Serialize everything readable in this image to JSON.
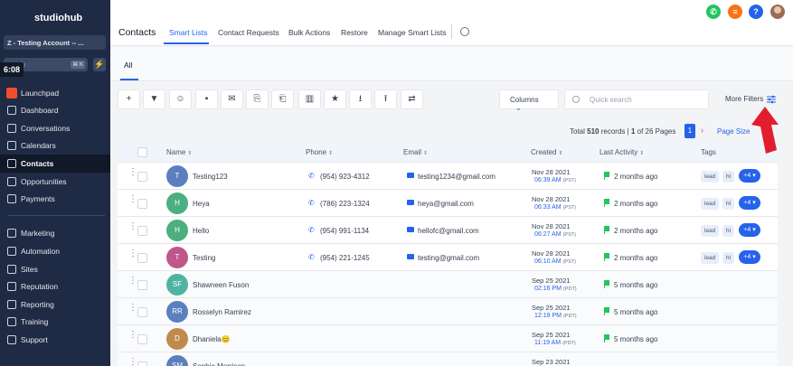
{
  "sidebar": {
    "logo": "studiohub",
    "account": "Z - Testing Account -- ...",
    "search_placeholder": "earch",
    "search_kbd": "⌘ K",
    "time_badge": "6:08",
    "items": [
      {
        "label": "Launchpad",
        "icon": "launchpad-icon"
      },
      {
        "label": "Dashboard",
        "icon": "dashboard-icon"
      },
      {
        "label": "Conversations",
        "icon": "chat-icon"
      },
      {
        "label": "Calendars",
        "icon": "calendar-icon"
      },
      {
        "label": "Contacts",
        "icon": "contacts-icon",
        "active": true
      },
      {
        "label": "Opportunities",
        "icon": "opportunities-icon"
      },
      {
        "label": "Payments",
        "icon": "payments-icon"
      },
      {
        "label": "Marketing",
        "icon": "marketing-icon"
      },
      {
        "label": "Automation",
        "icon": "automation-icon"
      },
      {
        "label": "Sites",
        "icon": "sites-icon"
      },
      {
        "label": "Reputation",
        "icon": "reputation-icon"
      },
      {
        "label": "Reporting",
        "icon": "reporting-icon"
      },
      {
        "label": "Training",
        "icon": "training-icon"
      },
      {
        "label": "Support",
        "icon": "support-icon"
      }
    ]
  },
  "header": {
    "title": "Contacts",
    "tabs": [
      "Smart Lists",
      "Contact Requests",
      "Bulk Actions",
      "Restore",
      "Manage Smart Lists"
    ],
    "help_label": "?",
    "colors": {
      "phone": "#22c55e",
      "menu": "#f97316",
      "help": "#2563eb"
    }
  },
  "subtabs": {
    "all": "All"
  },
  "toolbar": {
    "icons": [
      "plus-icon",
      "filter-icon",
      "robot-icon",
      "message-icon",
      "email-icon",
      "copy-in-icon",
      "copy-out-icon",
      "trash-icon",
      "star-icon",
      "download-icon",
      "upload-icon",
      "merge-icon"
    ],
    "icon_glyphs": [
      "+",
      "▼",
      "☺",
      "▪",
      "✉",
      "⎘",
      "⎗",
      "▥",
      "★",
      "⭳",
      "⭱",
      "⇄"
    ],
    "columns_label": "Columns",
    "search_placeholder": "Quick search",
    "more_filters": "More Filters"
  },
  "pagination": {
    "total_prefix": "Total",
    "total": "510",
    "total_suffix": "records |",
    "page": "1",
    "page_of": "of 26 Pages",
    "current": "1",
    "next": "›",
    "page_size": "Page Size"
  },
  "table": {
    "columns": [
      "Name",
      "Phone",
      "Email",
      "Created",
      "Last Activity",
      "Tags"
    ],
    "rows": [
      {
        "initials": "T",
        "name": "Testing123",
        "color": "#5b7fbf",
        "phone": "(954) 923-4312",
        "email": "testing1234@gmail.com",
        "date": "Nov 28 2021",
        "time": "06:39 AM",
        "tz": "(PST)",
        "activity": "2 months ago",
        "tags": [
          "lead",
          "hl"
        ],
        "more": "+4 ▾"
      },
      {
        "initials": "H",
        "name": "Heya",
        "color": "#4caf80",
        "phone": "(786) 223-1324",
        "email": "heya@gmail.com",
        "date": "Nov 28 2021",
        "time": "06:33 AM",
        "tz": "(PST)",
        "activity": "2 months ago",
        "tags": [
          "lead",
          "hl"
        ],
        "more": "+4 ▾"
      },
      {
        "initials": "H",
        "name": "Hello",
        "color": "#4caf80",
        "phone": "(954) 991-1134",
        "email": "hellofc@gmail.com",
        "date": "Nov 28 2021",
        "time": "06:27 AM",
        "tz": "(PST)",
        "activity": "2 months ago",
        "tags": [
          "lead",
          "hl"
        ],
        "more": "+4 ▾"
      },
      {
        "initials": "T",
        "name": "Testing",
        "color": "#c0578b",
        "phone": "(954) 221-1245",
        "email": "testing@gmail.com",
        "date": "Nov 28 2021",
        "time": "06:10 AM",
        "tz": "(PST)",
        "activity": "2 months ago",
        "tags": [
          "lead",
          "hl"
        ],
        "more": "+4 ▾"
      },
      {
        "initials": "SF",
        "name": "Shawneen Fuson",
        "color": "#4fb3a3",
        "date": "Sep 25 2021",
        "time": "02:16 PM",
        "tz": "(PDT)",
        "activity": "5 months ago"
      },
      {
        "initials": "RR",
        "name": "Rosselyn Ramirez",
        "color": "#5b7fbf",
        "date": "Sep 25 2021",
        "time": "12:19 PM",
        "tz": "(PDT)",
        "activity": "5 months ago"
      },
      {
        "initials": "D",
        "name": "Dhaniela😊",
        "color": "#c08a4d",
        "date": "Sep 25 2021",
        "time": "11:19 AM",
        "tz": "(PDT)",
        "activity": "5 months ago"
      },
      {
        "initials": "SM",
        "name": "Sophie Morrison",
        "color": "#5b7fbf",
        "date": "Sep 23 2021"
      }
    ]
  }
}
